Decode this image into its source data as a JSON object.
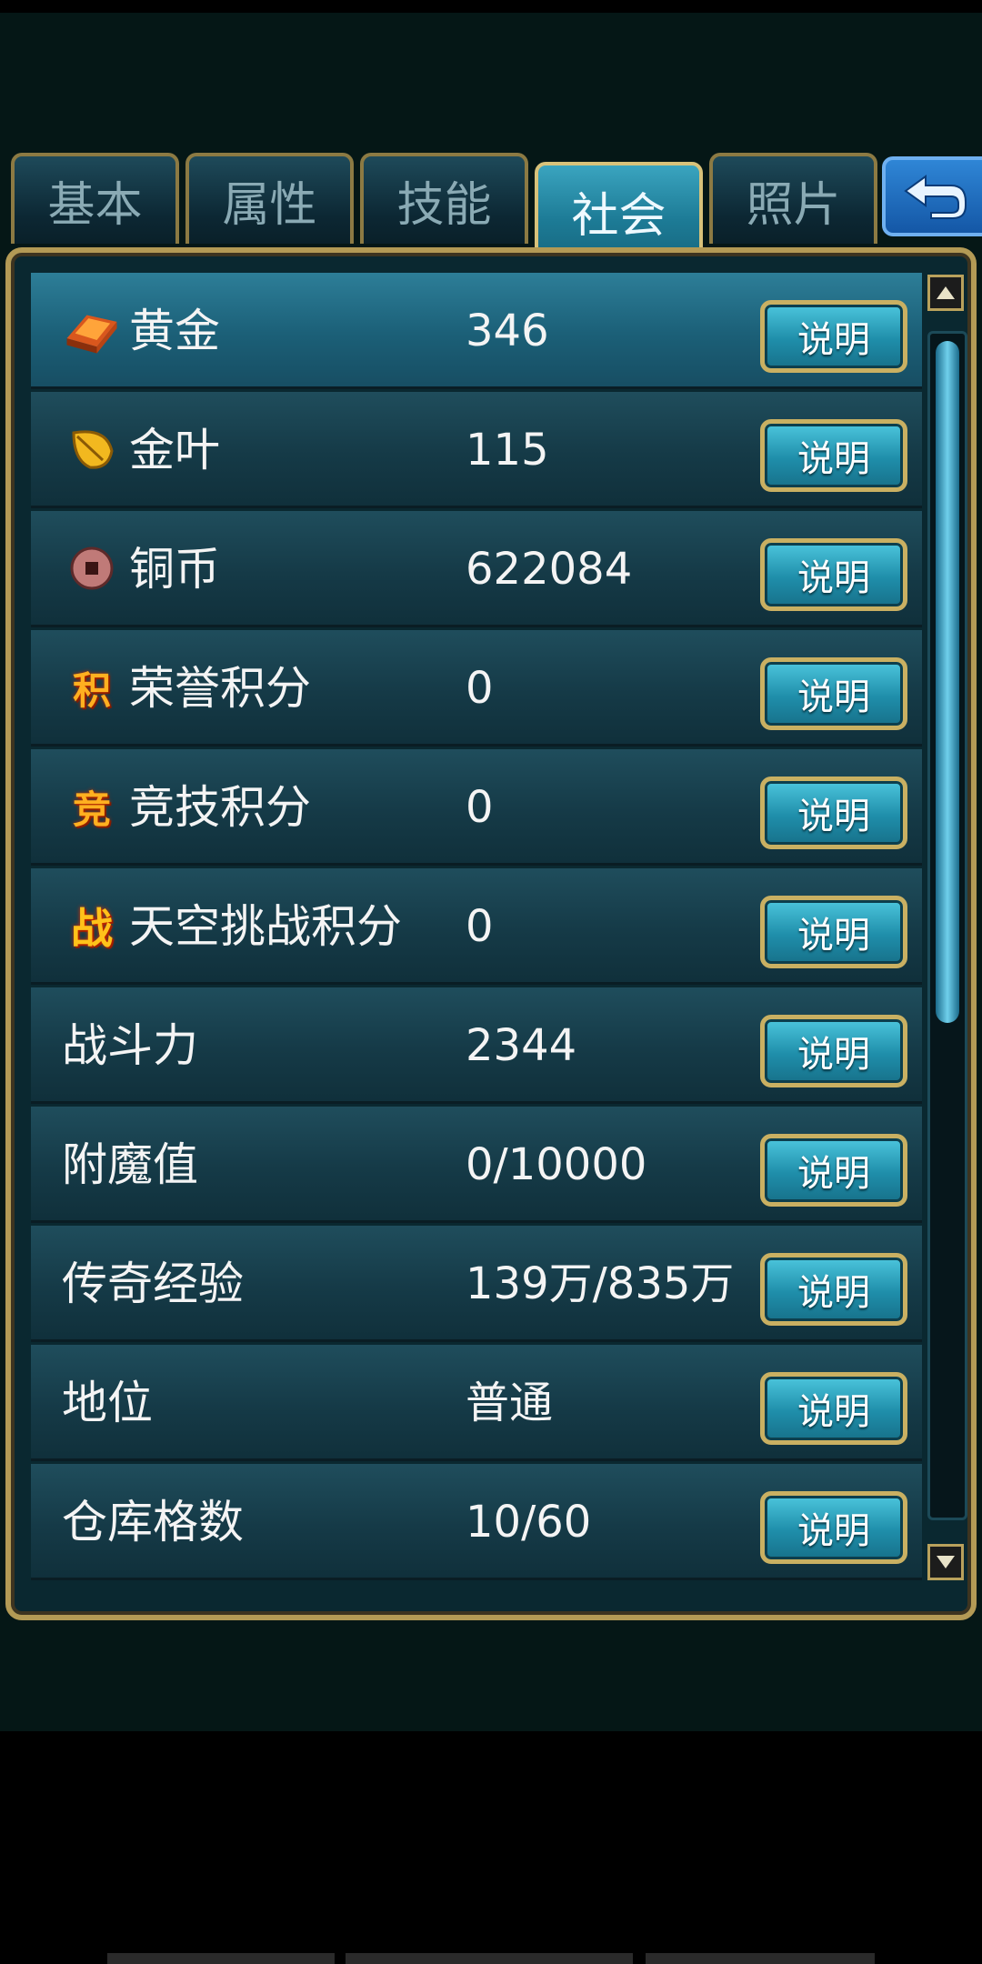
{
  "tabs": [
    {
      "label": "基本",
      "active": false
    },
    {
      "label": "属性",
      "active": false
    },
    {
      "label": "技能",
      "active": false
    },
    {
      "label": "社会",
      "active": true
    },
    {
      "label": "照片",
      "active": false
    }
  ],
  "back_icon": "return-arrow-icon",
  "button_label": "说明",
  "rows": [
    {
      "icon": "gold-ingot-icon",
      "label": "黄金",
      "value": "346"
    },
    {
      "icon": "gold-leaf-icon",
      "label": "金叶",
      "value": "115"
    },
    {
      "icon": "copper-coin-icon",
      "label": "铜币",
      "value": "622084"
    },
    {
      "icon": "honor-points-icon",
      "icon_text": "积",
      "label": "荣誉积分",
      "value": "0"
    },
    {
      "icon": "arena-points-icon",
      "icon_text": "竞",
      "label": "竞技积分",
      "value": "0"
    },
    {
      "icon": "sky-challenge-icon",
      "icon_text": "战",
      "label": "天空挑战积分",
      "value": "0"
    },
    {
      "label": "战斗力",
      "value": "2344"
    },
    {
      "label": "附魔值",
      "value": "0/10000"
    },
    {
      "label": "传奇经验",
      "value": "139万/835万"
    },
    {
      "label": "地位",
      "value": "普通"
    },
    {
      "label": "仓库格数",
      "value": "10/60"
    }
  ],
  "colors": {
    "accent_gold": "#b39a55",
    "active_tab": "#1d7b96",
    "row_bg": "#153a47",
    "text": "#f4f4f4"
  }
}
